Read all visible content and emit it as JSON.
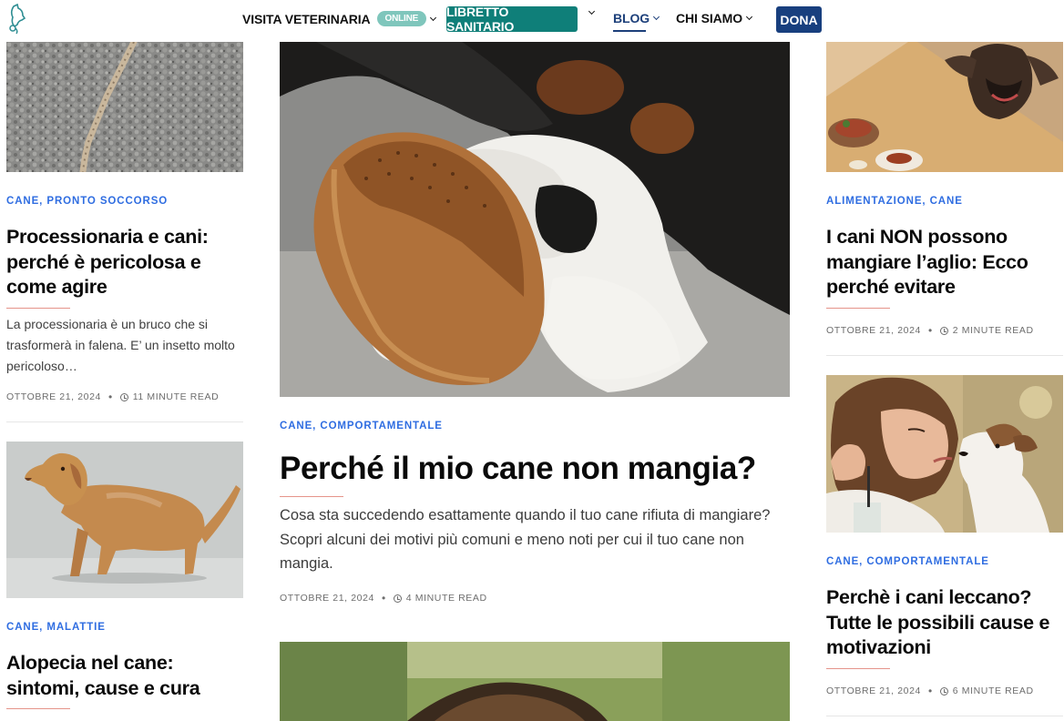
{
  "header": {
    "nav": {
      "visita": "VISITA VETERINARIA",
      "online_badge": "ONLINE",
      "libretto": "LIBRETTO SANITARIO",
      "blog": "BLOG",
      "chi_siamo": "CHI SIAMO",
      "dona": "DONA"
    }
  },
  "colors": {
    "category": "#2f6de1",
    "libretto_bg": "#0f7f79",
    "dona_bg": "#183f7e",
    "online_badge": "#7fc6bc",
    "accent_line": "#e5948a"
  },
  "articles": {
    "left1": {
      "categories": "CANE, PRONTO SOCCORSO",
      "title": "Processionaria e cani: perché è pericolosa e come agire",
      "excerpt": "La processionaria è un bruco che si trasformerà in falena. E’ un insetto molto pericoloso…",
      "date": "OTTOBRE 21, 2024",
      "read": "11 MINUTE READ"
    },
    "left2": {
      "categories": "CANE, MALATTIE",
      "title": "Alopecia nel cane: sintomi, cause e cura"
    },
    "center": {
      "categories": "CANE, COMPORTAMENTALE",
      "title": "Perché il mio cane non mangia?",
      "excerpt": "Cosa sta succedendo esattamente quando il tuo cane rifiuta di mangiare? Scopri alcuni dei motivi più comuni e meno noti per cui il tuo cane non mangia.",
      "date": "OTTOBRE 21, 2024",
      "read": "4 MINUTE READ"
    },
    "right1": {
      "categories": "ALIMENTAZIONE, CANE",
      "title": "I cani NON possono mangiare l’aglio: Ecco perché evitare",
      "date": "OTTOBRE 21, 2024",
      "read": "2 MINUTE READ"
    },
    "right2": {
      "categories": "CANE, COMPORTAMENTALE",
      "title": "Perchè i cani leccano? Tutte le possibili cause e motivazioni",
      "date": "OTTOBRE 21, 2024",
      "read": "6 MINUTE READ"
    }
  }
}
